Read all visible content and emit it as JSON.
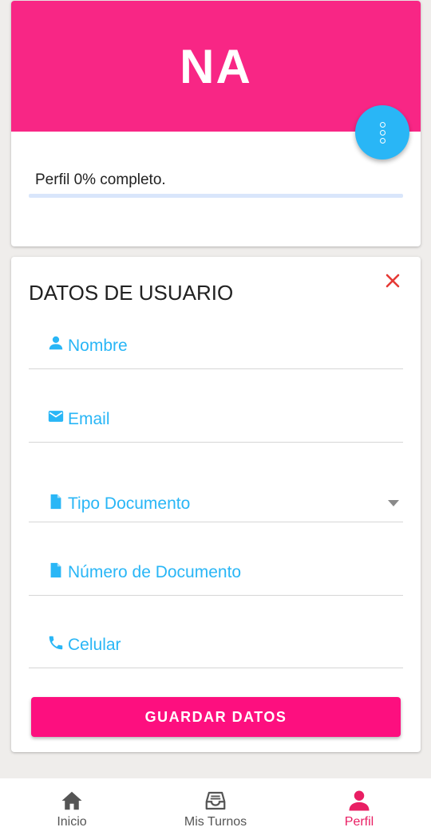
{
  "profile": {
    "initials": "NA",
    "progress_text": "Perfil 0% completo.",
    "progress_value": 0
  },
  "form": {
    "title": "DATOS DE USUARIO",
    "fields": {
      "nombre": "Nombre",
      "email": "Email",
      "tipo_documento": "Tipo Documento",
      "numero_documento": "Número de Documento",
      "celular": "Celular"
    },
    "save_label": "GUARDAR DATOS"
  },
  "nav": {
    "inicio": "Inicio",
    "mis_turnos": "Mis Turnos",
    "perfil": "Perfil",
    "active": "perfil"
  },
  "colors": {
    "header": "#f82685",
    "accent": "#29b6f6",
    "primary_button": "#fd0f7f",
    "close": "#e53935",
    "nav_active": "#e91e63"
  },
  "icons": {
    "fab": "more-vertical-icon",
    "close": "close-icon",
    "nombre": "person-icon",
    "email": "mail-icon",
    "tipo_documento": "document-icon",
    "numero_documento": "document-icon",
    "celular": "phone-icon",
    "inicio": "home-icon",
    "mis_turnos": "inbox-tray-icon",
    "perfil": "person-icon"
  }
}
